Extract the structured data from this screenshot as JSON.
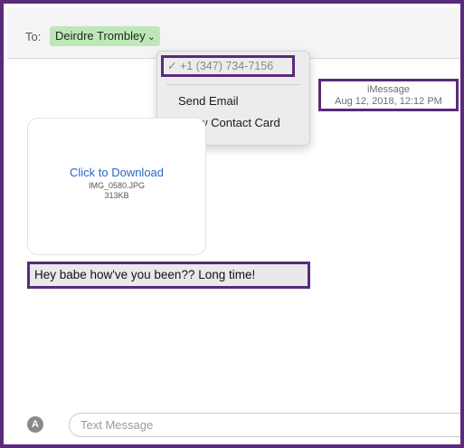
{
  "header": {
    "to_label": "To:",
    "recipient": "Deirdre Trombley",
    "chevron_icon": "chevron-down-icon"
  },
  "dropdown": {
    "checkmark_icon": "checkmark-icon",
    "phone": "+1 (347) 734-7156",
    "items": [
      "Send Email",
      "Show Contact Card"
    ]
  },
  "conversation": {
    "service": "iMessage",
    "timestamp": "Aug 12, 2018, 12:12 PM",
    "attachment": {
      "link": "Click to Download",
      "filename": "IMG_0580.JPG",
      "size": "313KB"
    },
    "message": "Hey babe how've you been?? Long time!"
  },
  "compose": {
    "appstore_icon": "app-store-icon",
    "appstore_glyph": "A",
    "placeholder": "Text Message"
  },
  "colors": {
    "highlight": "#5b2a7a",
    "recipient_chip": "#bfe6b9",
    "link": "#2a66c6"
  }
}
